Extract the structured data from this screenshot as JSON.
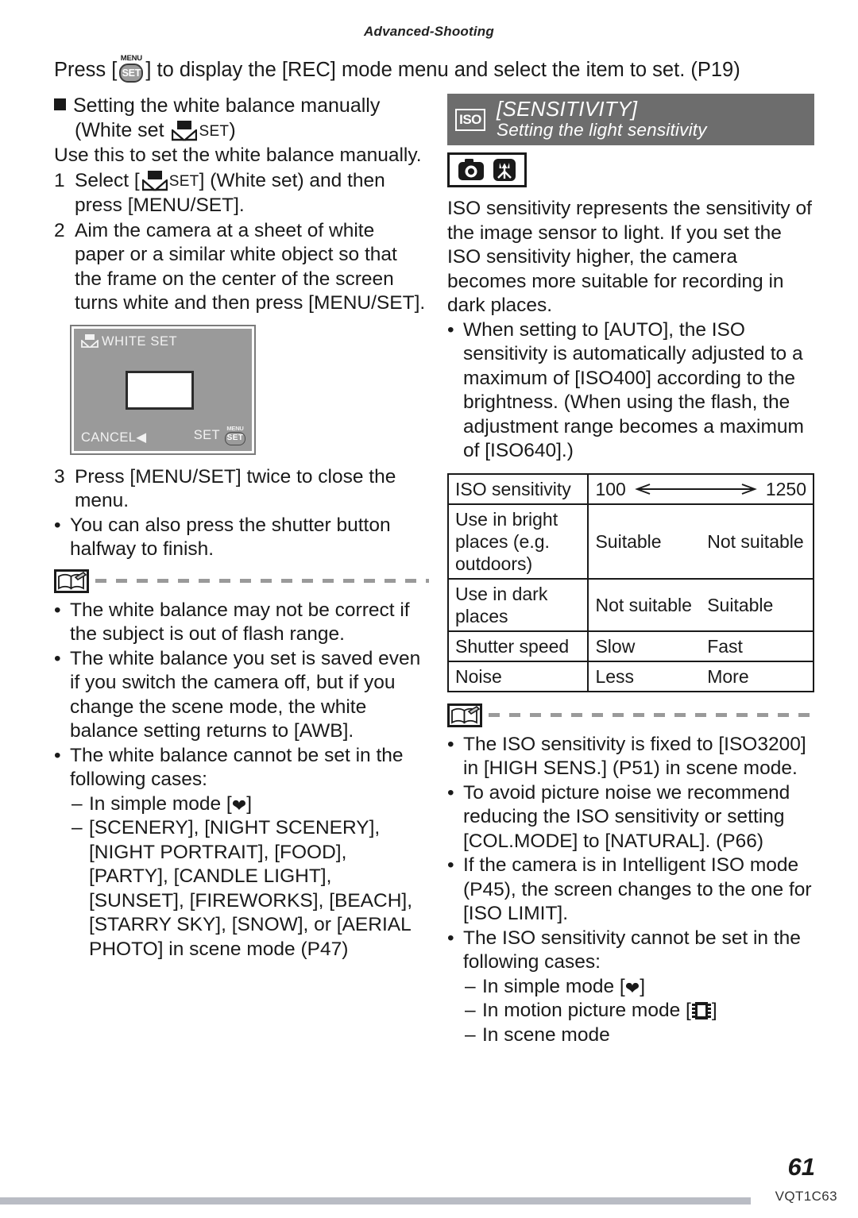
{
  "running_head": "Advanced-Shooting",
  "intro": {
    "before_icon": "Press [",
    "icon_menu_label": "MENU",
    "icon_set_label": "SET",
    "after_icon": "] to display the [REC] mode menu and select the item to set. (P19)"
  },
  "left": {
    "section_title_line1": "Setting the white balance manually",
    "section_title_line2_prefix": "(White set",
    "section_title_set_word": "SET",
    "section_title_line2_suffix": ")",
    "lead": "Use this to set the white balance manually.",
    "steps": [
      {
        "num": "1",
        "text_before_icon": "Select [",
        "set_word": "SET",
        "text_after_icon": "] (White set) and then press [MENU/SET]."
      },
      {
        "num": "2",
        "text": "Aim the camera at a sheet of white paper or a similar white object so that the frame on the center of the screen turns white and then press [MENU/SET]."
      },
      {
        "num": "3",
        "text": "Press [MENU/SET] twice to close the menu."
      }
    ],
    "lcd": {
      "title": "WHITE SET",
      "cancel": "CANCEL",
      "cancel_arrow": "◀",
      "set": "SET",
      "menu_label": "MENU",
      "set_button_label": "SET"
    },
    "after_step3_bullet": "You can also press the shutter button halfway to finish.",
    "notes": [
      "The white balance may not be correct if the subject is out of flash range.",
      "The white balance you set is saved even if you switch the camera off, but if you change the scene mode, the white balance setting returns to [AWB].",
      "The white balance cannot be set in the following cases:"
    ],
    "dashes": [
      {
        "text_before": "In simple mode [",
        "icon": "heart-icon",
        "text_after": "]"
      },
      {
        "text": "[SCENERY], [NIGHT SCENERY], [NIGHT PORTRAIT], [FOOD], [PARTY], [CANDLE LIGHT], [SUNSET], [FIREWORKS], [BEACH], [STARRY SKY], [SNOW], or [AERIAL PHOTO] in scene mode (P47)"
      }
    ]
  },
  "right": {
    "banner": {
      "badge": "ISO",
      "title": "[SENSITIVITY]",
      "subtitle": "Setting the light sensitivity"
    },
    "mode_icons": [
      "camera-icon",
      "macro-flower-icon"
    ],
    "intro": "ISO sensitivity represents the sensitivity of the image sensor to light. If you set the ISO sensitivity higher, the camera becomes more suitable for recording in dark places.",
    "intro_bullet": "When setting to [AUTO], the ISO sensitivity is automatically adjusted to a maximum of [ISO400] according to the brightness. (When using the flash, the adjustment range becomes a maximum of [ISO640].)",
    "table": {
      "row_sensitivity": {
        "label": "ISO sensitivity",
        "min": "100",
        "max": "1250"
      },
      "rows": [
        {
          "label": "Use in bright places (e.g. outdoors)",
          "low": "Suitable",
          "high": "Not suitable"
        },
        {
          "label": "Use in dark places",
          "low": "Not suitable",
          "high": "Suitable"
        },
        {
          "label": "Shutter speed",
          "low": "Slow",
          "high": "Fast"
        },
        {
          "label": "Noise",
          "low": "Less",
          "high": "More"
        }
      ]
    },
    "notes": [
      "The ISO sensitivity is fixed to [ISO3200] in [HIGH SENS.] (P51) in scene mode.",
      "To avoid picture noise we recommend reducing the ISO sensitivity or setting [COL.MODE] to [NATURAL]. (P66)",
      "If the camera is in Intelligent ISO mode (P45), the screen changes to the one for [ISO LIMIT].",
      "The ISO sensitivity cannot be set in the following cases:"
    ],
    "dashes": [
      {
        "text_before": "In simple mode [",
        "icon": "heart-icon",
        "text_after": "]"
      },
      {
        "text_before": "In motion picture mode [",
        "icon": "film-strip-icon",
        "text_after": "]"
      },
      {
        "text": "In scene mode"
      }
    ]
  },
  "footer": {
    "page_number": "61",
    "code": "VQT1C63"
  }
}
